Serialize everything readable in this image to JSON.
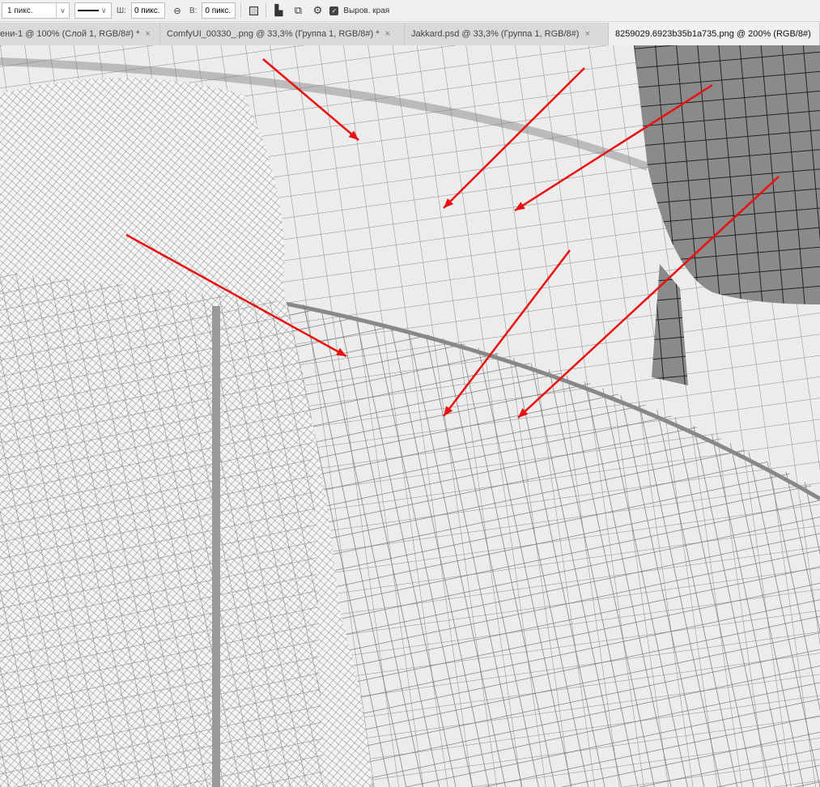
{
  "toolbar": {
    "stroke_width": "1 пикс.",
    "width_label": "Ш:",
    "width_value": "0 пикс.",
    "height_label": "В:",
    "height_value": "0 пикс.",
    "align_edges_label": "Выров. края",
    "align_edges_checked": true
  },
  "tabs": [
    {
      "label": "ени-1 @ 100% (Слой 1, RGB/8#) *",
      "active": false
    },
    {
      "label": "ComfyUI_00330_.png @ 33,3% (Группа 1, RGB/8#) *",
      "active": false
    },
    {
      "label": "Jakkard.psd @ 33,3% (Группа 1, RGB/8#)",
      "active": false
    },
    {
      "label": "8259029.6923b35b1a735.png @ 200% (RGB/8#)",
      "active": true
    }
  ],
  "close_glyph": "×",
  "colors": {
    "arrow": "#e8110f",
    "wire": "#555555",
    "surface": "#ececec"
  }
}
